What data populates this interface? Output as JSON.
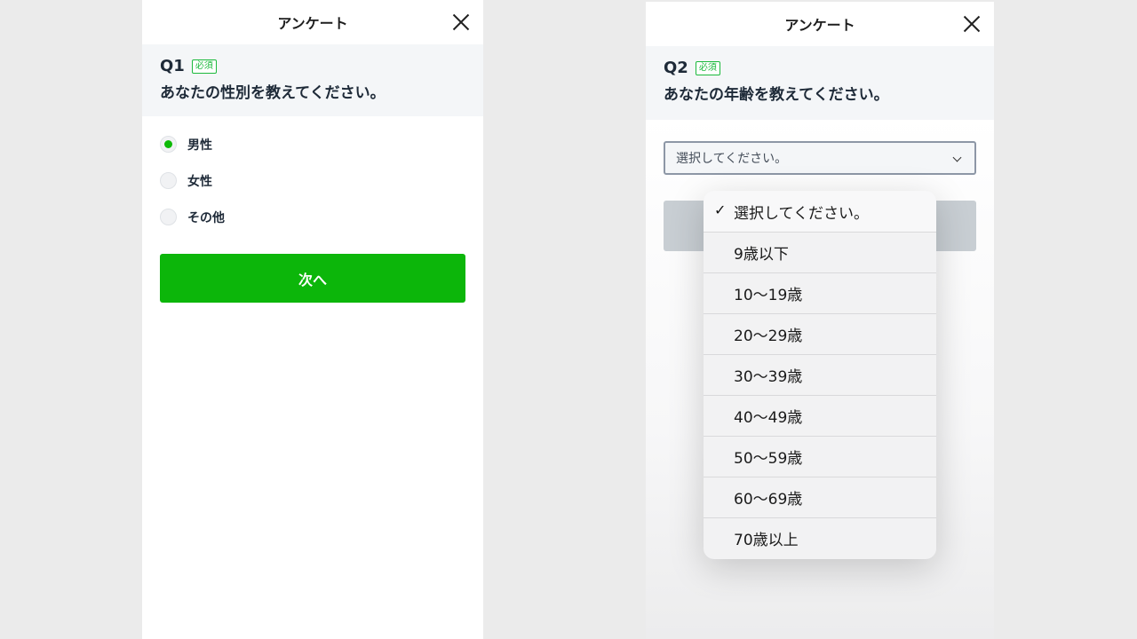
{
  "phone1": {
    "header_title": "アンケート",
    "question": {
      "number": "Q1",
      "required": "必須",
      "text": "あなたの性別を教えてください。"
    },
    "options": [
      {
        "label": "男性",
        "selected": true
      },
      {
        "label": "女性",
        "selected": false
      },
      {
        "label": "その他",
        "selected": false
      }
    ],
    "next_label": "次へ"
  },
  "phone2": {
    "header_title": "アンケート",
    "question": {
      "number": "Q2",
      "required": "必須",
      "text": "あなたの年齢を教えてください。"
    },
    "select_value": "選択してください。"
  },
  "dropdown": {
    "items": [
      "選択してください。",
      "9歳以下",
      "10～19歳",
      "20～29歳",
      "30～39歳",
      "40～49歳",
      "50～59歳",
      "60～69歳",
      "70歳以上"
    ],
    "selected_index": 0,
    "check_glyph": "✓"
  },
  "colors": {
    "accent": "#0cb60a",
    "required": "#1bb93c",
    "question_bg": "#f4f6f8",
    "disabled": "#c8ced3"
  }
}
